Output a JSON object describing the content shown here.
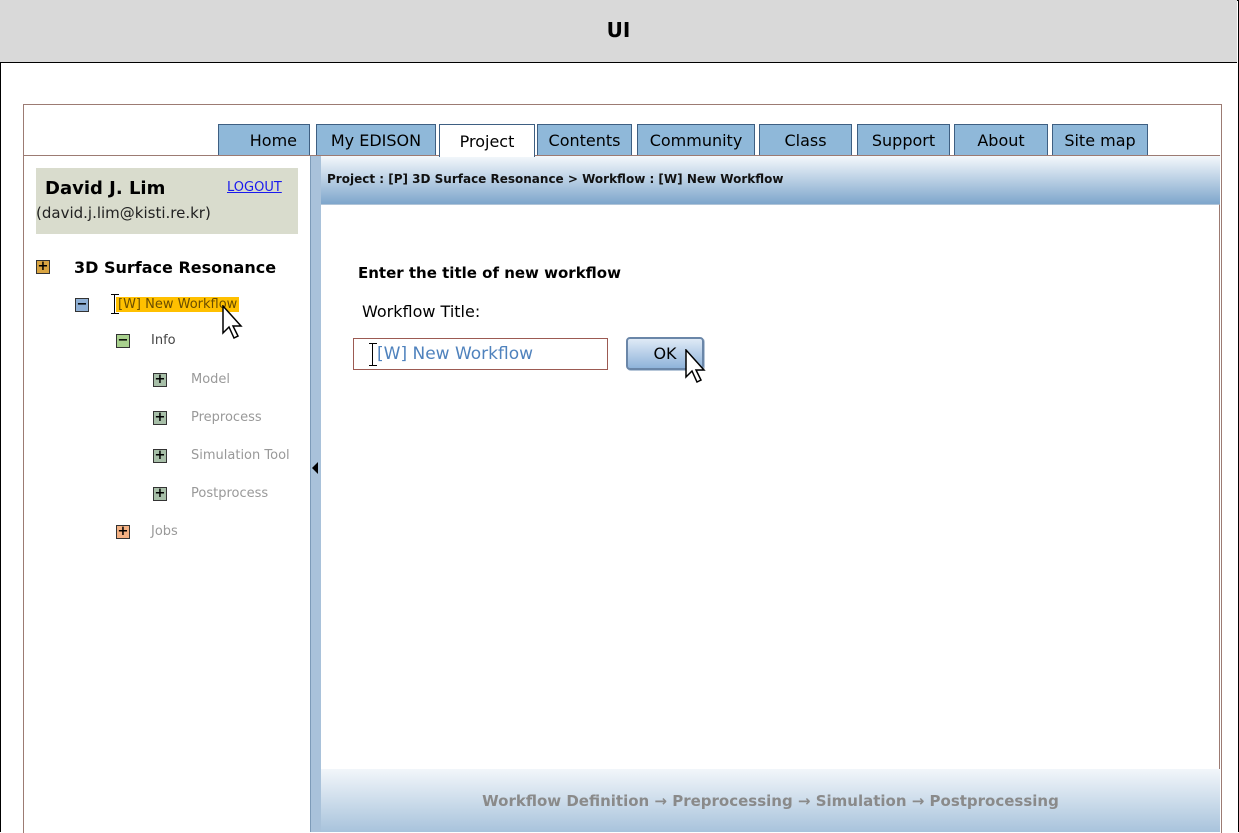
{
  "header": {
    "title": "UI"
  },
  "nav": {
    "tabs": [
      {
        "label": "Home"
      },
      {
        "label": "My EDISON"
      },
      {
        "label": "Project"
      },
      {
        "label": "Contents"
      },
      {
        "label": "Community"
      },
      {
        "label": "Class"
      },
      {
        "label": "Support"
      },
      {
        "label": "About"
      },
      {
        "label": "Site map"
      }
    ],
    "active_tab": "Project"
  },
  "user": {
    "name": "David J. Lim",
    "email": "(david.j.lim@kisti.re.kr)",
    "logout_label": "LOGOUT"
  },
  "tree": {
    "project": {
      "toggle": "+",
      "label": "3D Surface Resonance"
    },
    "workflow": {
      "toggle": "−",
      "label": "[W] New Workflow"
    },
    "info": {
      "toggle": "−",
      "label": "Info"
    },
    "children": [
      {
        "toggle": "+",
        "label": "Model"
      },
      {
        "toggle": "+",
        "label": "Preprocess"
      },
      {
        "toggle": "+",
        "label": "Simulation Tool"
      },
      {
        "toggle": "+",
        "label": "Postprocess"
      }
    ],
    "jobs": {
      "toggle": "+",
      "label": "Jobs"
    }
  },
  "breadcrumb": "Project : [P] 3D Surface Resonance > Workflow : [W] New Workflow",
  "form": {
    "heading": "Enter the title of new workflow",
    "field_label": "Workflow Title:",
    "title_value": "[W] New Workflow",
    "ok_label": "OK"
  },
  "footer": {
    "steps": "Workflow Definition → Preprocessing → Simulation → Postprocessing"
  },
  "colors": {
    "tab_bg": "#8fb8d9",
    "highlight": "#ffc000",
    "user_box": "#d9dccd"
  },
  "icons": [
    "plus-toggle-icon",
    "minus-toggle-icon",
    "mouse-pointer-icon",
    "text-cursor-icon",
    "collapse-arrow-icon"
  ]
}
